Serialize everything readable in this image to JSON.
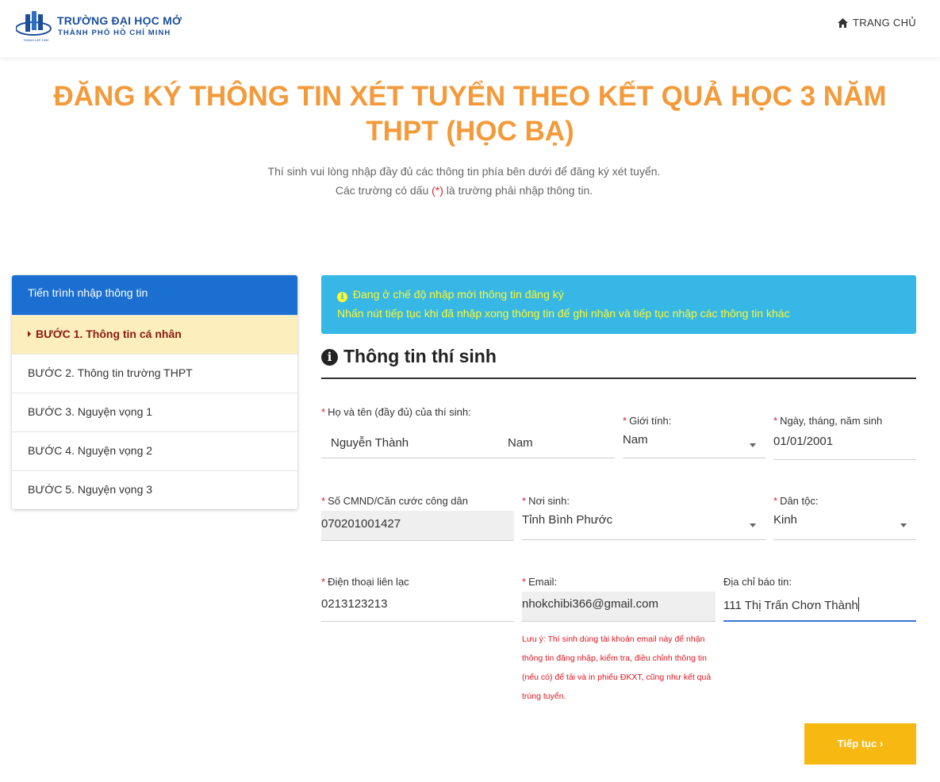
{
  "header": {
    "logo_line1": "TRƯỜNG ĐẠI HỌC MỞ",
    "logo_line2": "THÀNH PHỐ HỒ CHÍ MINH",
    "logo_sub": "THÀNH LẬP 1990",
    "home_label": "TRANG CHỦ",
    "home_icon": "home-icon"
  },
  "page": {
    "title": "ĐĂNG KÝ THÔNG TIN XÉT TUYỂN THEO KẾT QUẢ HỌC 3 NĂM THPT (HỌC BẠ)",
    "intro_line1": "Thí sinh vui lòng nhập đầy đủ các thông tin phía bên dưới để đăng ký xét tuyển.",
    "intro_line2_prefix": "Các trường có dấu",
    "intro_line2_marker": "(*)",
    "intro_line2_suffix": "là trường phải nhập thông tin."
  },
  "sidebar": {
    "heading": "Tiến trình nhập thông tin",
    "items": [
      {
        "label": "BƯỚC 1. Thông tin cá nhân",
        "active": true
      },
      {
        "label": "BƯỚC 2. Thông tin trường THPT",
        "active": false
      },
      {
        "label": "BƯỚC 3. Nguyện vọng 1",
        "active": false
      },
      {
        "label": "BƯỚC 4. Nguyện vọng 2",
        "active": false
      },
      {
        "label": "BƯỚC 5. Nguyện vọng 3",
        "active": false
      }
    ]
  },
  "info_box": {
    "line1": "Đang ở chế độ nhập mới thông tin đăng ký",
    "line2": "Nhấn nút tiếp tục khi đã nhập xong thông tin để ghi nhận và tiếp tục nhập các thông tin khác",
    "icon": "info-circle-icon",
    "text_color": "#fff830",
    "background": "#36b7e5"
  },
  "section": {
    "title": "Thông tin thí sinh",
    "icon": "info-circle-icon"
  },
  "form": {
    "full_name": {
      "label": "Họ và tên (đầy đủ) của thí sinh:",
      "value_first": "Nguyễn Thành",
      "value_last": "Nam",
      "required": true
    },
    "gender": {
      "label": "Giới tính:",
      "value": "Nam",
      "required": true
    },
    "dob": {
      "label": "Ngày, tháng, năm sinh",
      "value": "01/01/2001",
      "required": true
    },
    "id_number": {
      "label": "Số CMND/Căn cước công dân",
      "value": "070201001427",
      "required": true
    },
    "birthplace": {
      "label": "Nơi sinh:",
      "value": "Tỉnh Bình Phước",
      "required": true
    },
    "ethnicity": {
      "label": "Dân tộc:",
      "value": "Kinh",
      "required": true
    },
    "phone": {
      "label": "Điện thoại liên lạc",
      "value": "0213123213",
      "required": true
    },
    "email": {
      "label": "Email:",
      "value": "nhokchibi366@gmail.com",
      "required": true
    },
    "address": {
      "label": "Địa chỉ báo tin:",
      "value": "111 Thị Trấn Chơn Thành",
      "required": false
    },
    "email_note": "Lưu ý: Thí sinh dùng tài khoản email này để nhận thông tin đăng nhập, kiểm tra, điều chỉnh thông tin (nếu có) để tải và in phiếu ĐKXT, cũng như kết quả trúng tuyển."
  },
  "actions": {
    "continue_label": "Tiếp tục ›",
    "continue_color": "#f7b812"
  },
  "colors": {
    "title": "#f39a3a",
    "sidebar_header": "#1a6fd0",
    "sidebar_active_bg": "#fdeebd",
    "required_star": "#d9242f"
  }
}
